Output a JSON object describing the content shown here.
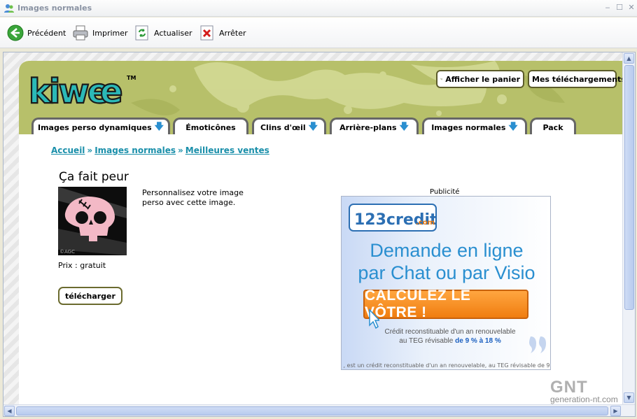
{
  "window": {
    "title": "Images normales"
  },
  "toolbar": {
    "back": "Précédent",
    "print": "Imprimer",
    "refresh": "Actualiser",
    "stop": "Arrêter"
  },
  "header": {
    "logo": "kiwee",
    "tm": "TM",
    "cart_button": "Afficher le panier",
    "downloads_button": "Mes téléchargements"
  },
  "tabs": [
    {
      "label": "Images perso dynamiques",
      "arrow": "🡇"
    },
    {
      "label": "Émoticônes",
      "arrow": ""
    },
    {
      "label": "Clins d'œil",
      "arrow": "🡇"
    },
    {
      "label": "Arrière-plans",
      "arrow": "🡇"
    },
    {
      "label": "Images normales",
      "arrow": "🡇"
    },
    {
      "label": "Pack",
      "arrow": ""
    }
  ],
  "breadcrumb": {
    "home": "Accueil",
    "section": "Images normales",
    "current": "Meilleures ventes",
    "separator": "»"
  },
  "product": {
    "title": "Ça fait peur",
    "description": "Personnalisez votre image perso avec cette image.",
    "price": "Prix : gratuit",
    "download": "télécharger",
    "thumb_caption": "©AGC"
  },
  "ad": {
    "label": "Publicité",
    "brand": "123credit",
    "brand_suffix": ".com",
    "line1": "Demande en ligne",
    "line2": "par Chat ou par Visio",
    "cta": "CALCULEZ LE VÔTRE !",
    "note1": "Crédit reconstituable d'un an renouvelable",
    "note2a": "au TEG révisable ",
    "note2b": "de 9 % à 18 %",
    "fine": ", est un crédit reconstituable d'un an renouvelable, au TEG révisable de 9"
  },
  "watermark": {
    "big": "GNT",
    "sub": "generation-nt.com"
  },
  "colors": {
    "header_green": "#b7c06a",
    "link_teal": "#1a8faa",
    "ad_blue": "#2a8fd0",
    "cta_orange": "#f07d10"
  }
}
